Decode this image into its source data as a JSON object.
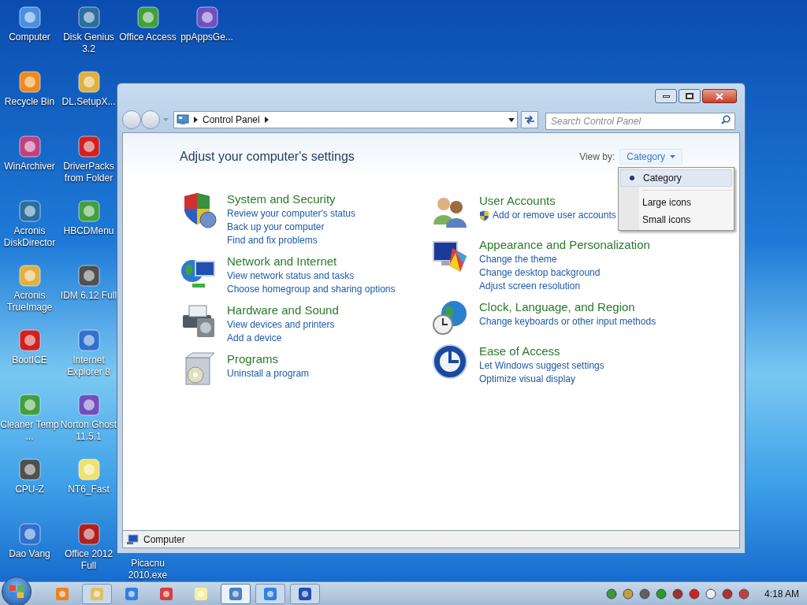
{
  "desktop": {
    "columns": [
      [
        {
          "label": "Computer"
        },
        {
          "label": "Recycle Bin"
        },
        {
          "label": "WinArchiver"
        },
        {
          "label": "Acronis DiskDirector"
        },
        {
          "label": "Acronis TrueImage"
        },
        {
          "label": "BootICE"
        },
        {
          "label": "Cleaner Temp ..."
        },
        {
          "label": "CPU-Z"
        },
        {
          "label": "Dao Vang"
        }
      ],
      [
        {
          "label": "Disk Genius 3.2"
        },
        {
          "label": "DL.SetupX..."
        },
        {
          "label": "DriverPacks from Folder"
        },
        {
          "label": "HBCDMenu"
        },
        {
          "label": "IDM 6.12 Full"
        },
        {
          "label": "Internet Explorer 8"
        },
        {
          "label": "Norton Ghost 11.5.1"
        },
        {
          "label": "NT6_Fast"
        },
        {
          "label": "Office 2012 Full"
        }
      ],
      [
        {
          "label": "Office Access"
        },
        {
          "label": "Picacnu 2010.exe"
        }
      ],
      [
        {
          "label": "ppAppsGe..."
        }
      ]
    ]
  },
  "window": {
    "address": {
      "path": [
        "Control Panel"
      ],
      "search_placeholder": "Search Control Panel"
    },
    "heading": "Adjust your computer's settings",
    "view_by": {
      "label": "View by:",
      "value": "Category"
    },
    "view_menu": [
      {
        "label": "Category",
        "selected": true
      },
      {
        "label": "Large icons",
        "selected": false
      },
      {
        "label": "Small icons",
        "selected": false
      }
    ],
    "categories": [
      [
        {
          "title": "System and Security",
          "links": [
            {
              "text": "Review your computer's status",
              "shield": false
            },
            {
              "text": "Back up your computer",
              "shield": false
            },
            {
              "text": "Find and fix problems",
              "shield": false
            }
          ]
        },
        {
          "title": "Network and Internet",
          "links": [
            {
              "text": "View network status and tasks",
              "shield": false
            },
            {
              "text": "Choose homegroup and sharing options",
              "shield": false
            }
          ]
        },
        {
          "title": "Hardware and Sound",
          "links": [
            {
              "text": "View devices and printers",
              "shield": false
            },
            {
              "text": "Add a device",
              "shield": false
            }
          ]
        },
        {
          "title": "Programs",
          "links": [
            {
              "text": "Uninstall a program",
              "shield": false
            }
          ]
        }
      ],
      [
        {
          "title": "User Accounts",
          "links": [
            {
              "text": "Add or remove user accounts",
              "shield": true
            }
          ]
        },
        {
          "title": "Appearance and Personalization",
          "links": [
            {
              "text": "Change the theme",
              "shield": false
            },
            {
              "text": "Change desktop background",
              "shield": false
            },
            {
              "text": "Adjust screen resolution",
              "shield": false
            }
          ]
        },
        {
          "title": "Clock, Language, and Region",
          "links": [
            {
              "text": "Change keyboards or other input methods",
              "shield": false
            }
          ]
        },
        {
          "title": "Ease of Access",
          "links": [
            {
              "text": "Let Windows suggest settings",
              "shield": false
            },
            {
              "text": "Optimize visual display",
              "shield": false
            }
          ]
        }
      ]
    ],
    "status_bar": {
      "text": "Computer"
    }
  },
  "taskbar": {
    "items": [
      {
        "open": false,
        "selected": false
      },
      {
        "open": true,
        "selected": false
      },
      {
        "open": false,
        "selected": false
      },
      {
        "open": false,
        "selected": false
      },
      {
        "open": false,
        "selected": false
      },
      {
        "open": true,
        "selected": true
      },
      {
        "open": true,
        "selected": false
      },
      {
        "open": true,
        "selected": false
      }
    ],
    "clock": "4:18 AM"
  }
}
